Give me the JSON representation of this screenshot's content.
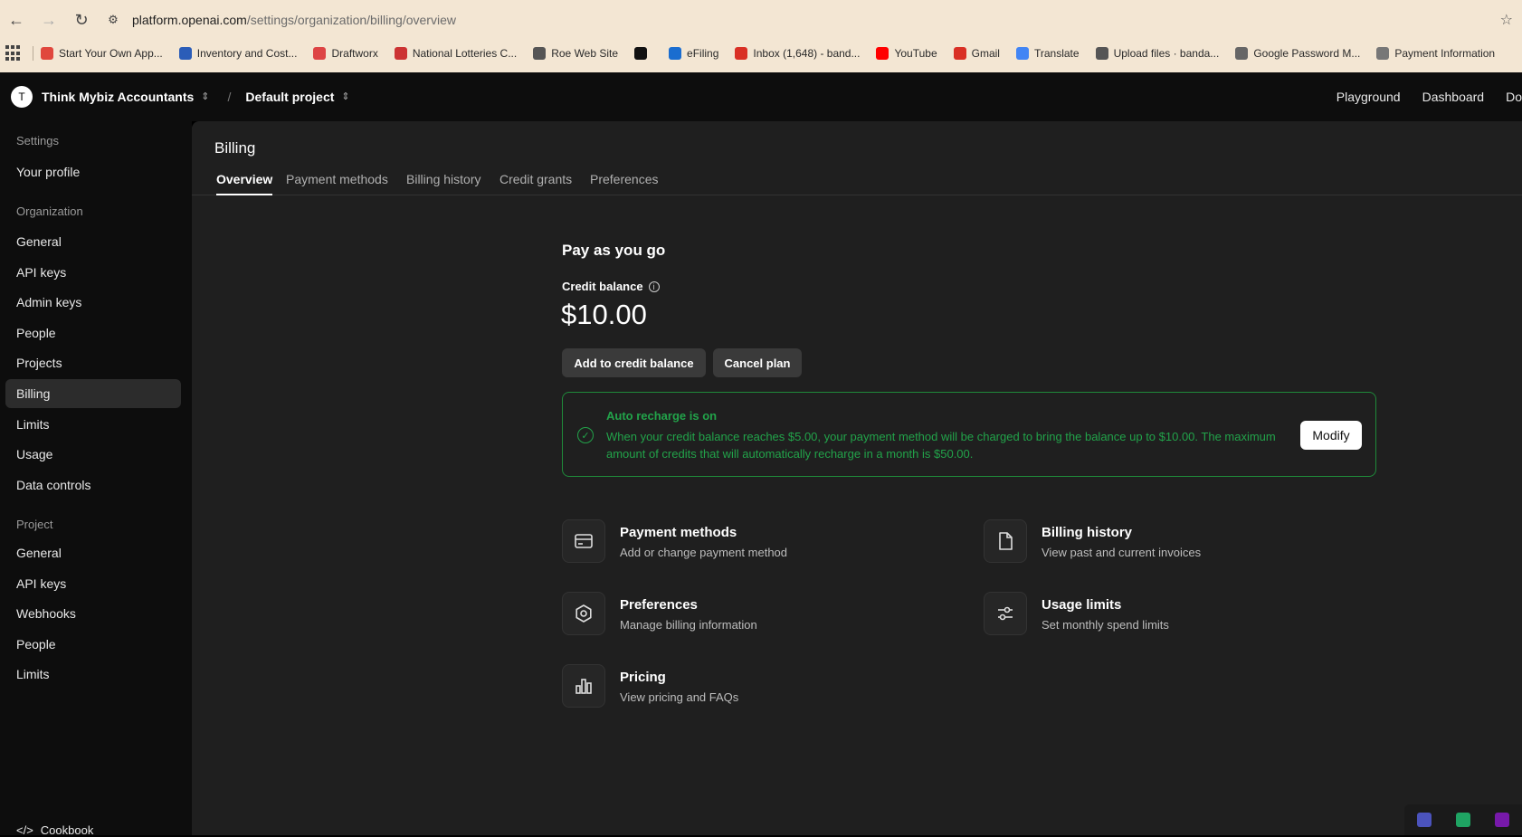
{
  "browser": {
    "url_host": "platform.openai.com",
    "url_path": "/settings/organization/billing/overview",
    "bookmarks": [
      {
        "label": "Start Your Own App...",
        "color": "#e0473d"
      },
      {
        "label": "Inventory and Cost...",
        "color": "#2b5db8"
      },
      {
        "label": "Draftworx",
        "color": "#d44"
      },
      {
        "label": "National Lotteries C...",
        "color": "#c33"
      },
      {
        "label": "Roe Web Site",
        "color": "#555"
      },
      {
        "label": "",
        "color": "#111"
      },
      {
        "label": "eFiling",
        "color": "#1a6dd0"
      },
      {
        "label": "Inbox (1,648) - band...",
        "color": "#d93025"
      },
      {
        "label": "YouTube",
        "color": "#ff0000"
      },
      {
        "label": "Gmail",
        "color": "#d93025"
      },
      {
        "label": "Translate",
        "color": "#4285f4"
      },
      {
        "label": "Upload files · banda...",
        "color": "#555"
      },
      {
        "label": "Google Password M...",
        "color": "#666"
      },
      {
        "label": "Payment Information",
        "color": "#777"
      }
    ]
  },
  "topbar": {
    "org_initial": "T",
    "org_name": "Think Mybiz Accountants",
    "project_name": "Default project",
    "links": [
      "Playground",
      "Dashboard",
      "Do"
    ]
  },
  "sidebar": {
    "settings_heading": "Settings",
    "your_profile": "Your profile",
    "organization_heading": "Organization",
    "org_items": [
      "General",
      "API keys",
      "Admin keys",
      "People",
      "Projects",
      "Billing",
      "Limits",
      "Usage",
      "Data controls"
    ],
    "project_heading": "Project",
    "project_items": [
      "General",
      "API keys",
      "Webhooks",
      "People",
      "Limits"
    ],
    "cookbook": "Cookbook"
  },
  "main": {
    "title": "Billing",
    "tabs": [
      "Overview",
      "Payment methods",
      "Billing history",
      "Credit grants",
      "Preferences"
    ],
    "plan_title": "Pay as you go",
    "credit_balance_label": "Credit balance",
    "credit_balance": "$10.00",
    "add_credit_button": "Add to credit balance",
    "cancel_plan_button": "Cancel plan",
    "auto_recharge": {
      "title": "Auto recharge is on",
      "text": "When your credit balance reaches $5.00, your payment method will be charged to bring the balance up to $10.00. The maximum amount of credits that will automatically recharge in a month is $50.00.",
      "modify_button": "Modify"
    },
    "cards": [
      {
        "title": "Payment methods",
        "desc": "Add or change payment method",
        "icon": "credit-card-icon"
      },
      {
        "title": "Billing history",
        "desc": "View past and current invoices",
        "icon": "document-icon"
      },
      {
        "title": "Preferences",
        "desc": "Manage billing information",
        "icon": "gear-icon"
      },
      {
        "title": "Usage limits",
        "desc": "Set monthly spend limits",
        "icon": "sliders-icon"
      },
      {
        "title": "Pricing",
        "desc": "View pricing and FAQs",
        "icon": "bar-chart-icon"
      }
    ]
  }
}
